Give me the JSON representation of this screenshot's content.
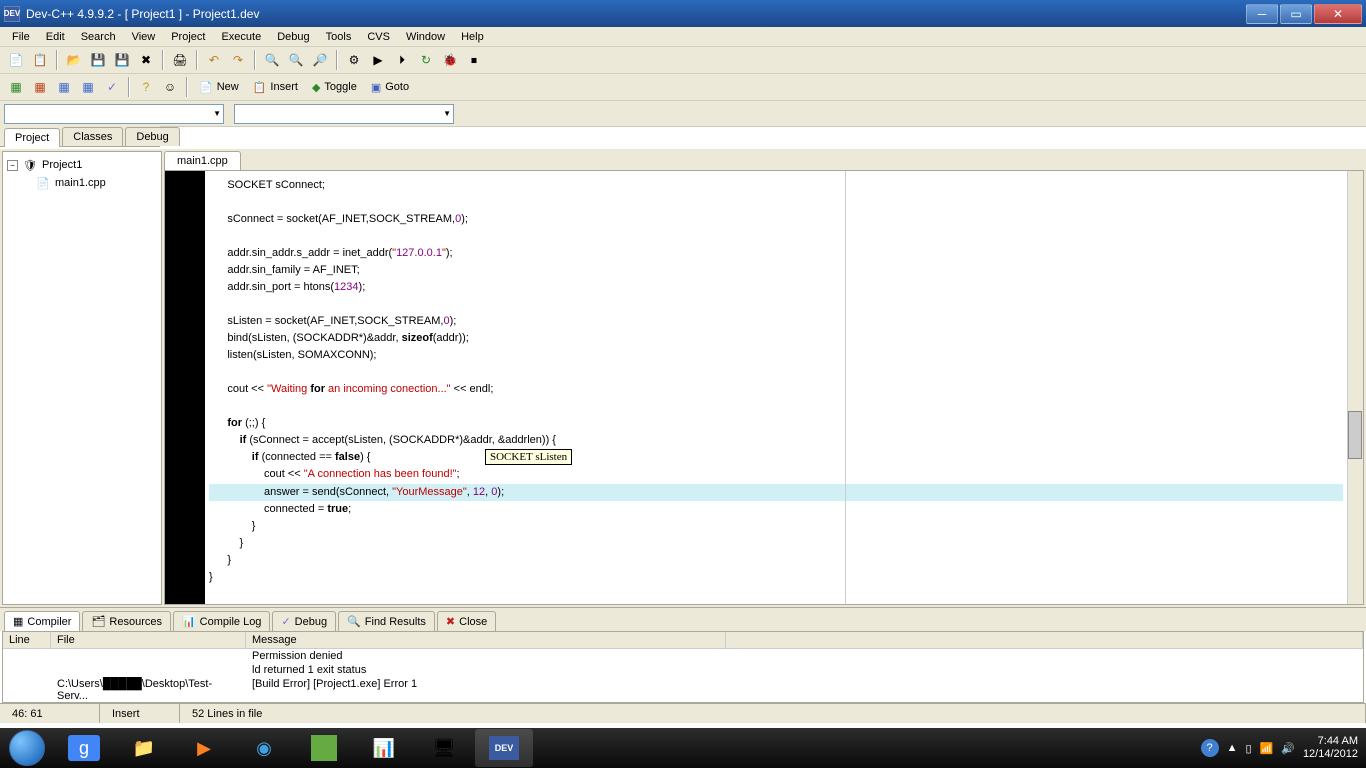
{
  "window": {
    "title": "Dev-C++ 4.9.9.2  -  [ Project1 ] - Project1.dev",
    "app_icon_text": "DEV"
  },
  "menu": {
    "items": [
      "File",
      "Edit",
      "Search",
      "View",
      "Project",
      "Execute",
      "Debug",
      "Tools",
      "CVS",
      "Window",
      "Help"
    ]
  },
  "toolbar2": {
    "new": "New",
    "insert": "Insert",
    "toggle": "Toggle",
    "goto": "Goto"
  },
  "sidebar_tabs": [
    "Project",
    "Classes",
    "Debug"
  ],
  "tree": {
    "root": "Project1",
    "child": "main1.cpp"
  },
  "editor_tab": "main1.cpp",
  "code_lines": [
    "      SOCKET sConnect;",
    "",
    "      sConnect = socket(AF_INET,SOCK_STREAM,0);",
    "",
    "      addr.sin_addr.s_addr = inet_addr(\"127.0.0.1\");",
    "      addr.sin_family = AF_INET;",
    "      addr.sin_port = htons(1234);",
    "",
    "      sListen = socket(AF_INET,SOCK_STREAM,0);",
    "      bind(sListen, (SOCKADDR*)&addr, sizeof(addr));",
    "      listen(sListen, SOMAXCONN);",
    "",
    "      cout << \"Waiting for an incoming conection...\" << endl;",
    "",
    "      for (;;) {",
    "          if (sConnect = accept(sListen, (SOCKADDR*)&addr, &addrlen)) {",
    "              if (connected == false) {",
    "                  cout << \"A connection has been found!\";",
    "                  answer = send(sConnect, \"YourMessage\", 12, 0);",
    "                  connected = true;",
    "              }",
    "          }",
    "      }",
    "}"
  ],
  "tooltip": "SOCKET sListen",
  "bottom_tabs": [
    "Compiler",
    "Resources",
    "Compile Log",
    "Debug",
    "Find Results",
    "Close"
  ],
  "compiler_table": {
    "headers": {
      "line": "Line",
      "file": "File",
      "message": "Message"
    },
    "rows": [
      {
        "line": "",
        "file": "",
        "message": "Permission denied"
      },
      {
        "line": "",
        "file": "",
        "message": "ld returned 1 exit status"
      },
      {
        "line": "",
        "file": "C:\\Users\\█████\\Desktop\\Test-Serv...",
        "message": "[Build Error]  [Project1.exe] Error 1"
      }
    ]
  },
  "status": {
    "pos": "46: 61",
    "mode": "Insert",
    "lines": "52 Lines in file"
  },
  "tray": {
    "time": "7:44 AM",
    "date": "12/14/2012"
  }
}
